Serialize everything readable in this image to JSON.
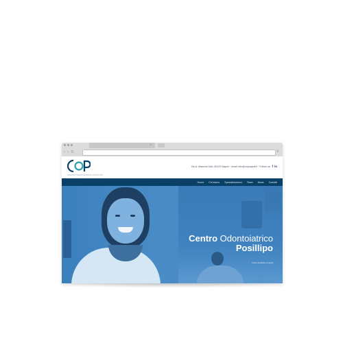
{
  "browser": {
    "url": "",
    "tab_close": "×"
  },
  "site": {
    "logo_text": "COP",
    "logo_tagline": "CENTRO ODONTOIATRICO POSILLIPO",
    "contact": "Via A. Manzoni 2a/b, 80123 Napoli · email: info@copnapoli.it · Follow us:",
    "social": [
      "f",
      "in"
    ],
    "nav": [
      "Home",
      "Chi siamo",
      "Specializzazioni",
      "Team",
      "News",
      "Contatti"
    ]
  },
  "hero": {
    "title_bold": "Centro",
    "title_light": "Odontoiatrico",
    "title_line2": "Posillipo",
    "subtitle": "centro dentistico a napoli"
  },
  "colors": {
    "navbar": "#0a3f66",
    "hero": "#4a8cc6",
    "accent": "#0a3f66"
  }
}
